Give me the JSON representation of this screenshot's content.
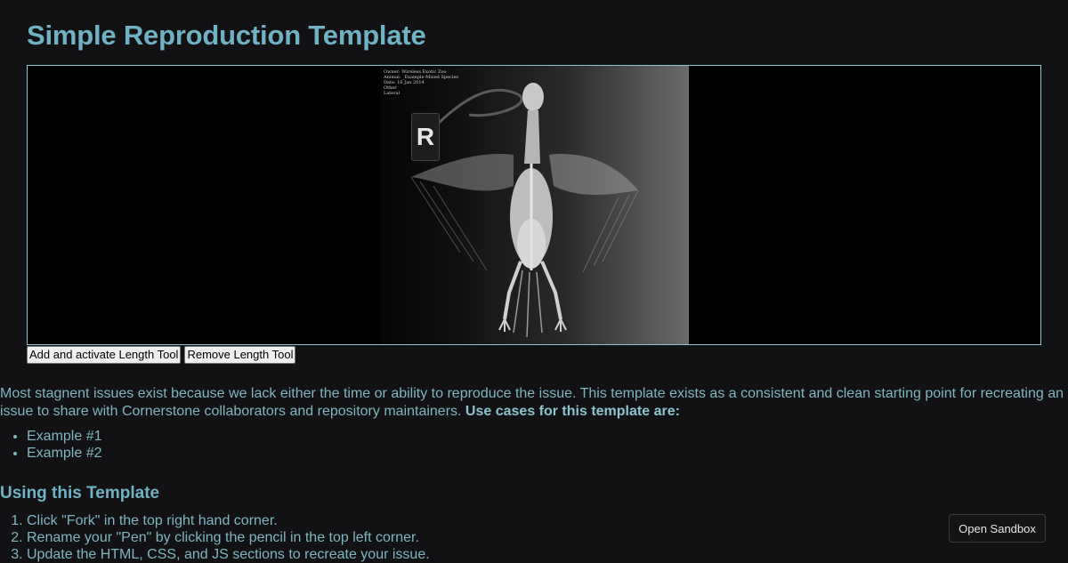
{
  "page": {
    "title": "Simple Reproduction Template"
  },
  "viewport": {
    "overlay_lines": [
      "Owner: Wireless Exotic Zoo",
      "Animal: _Example-Mixed Species",
      "Date: 16 Jan 2014",
      "Other",
      "Lateral"
    ],
    "marker_letter": "R"
  },
  "toolbar": {
    "add_length_label": "Add and activate Length Tool",
    "remove_length_label": "Remove Length Tool"
  },
  "intro": {
    "text": "Most stagnent issues exist because we lack either the time or ability to reproduce the issue. This template exists as a consistent and clean starting point for recreating an issue to share with Cornerstone collaborators and repository maintainers. ",
    "strong": "Use cases for this template are:"
  },
  "examples": [
    "Example #1",
    "Example #2"
  ],
  "using": {
    "title": "Using this Template",
    "steps": [
      "Click \"Fork\" in the top right hand corner.",
      "Rename your \"Pen\" by clicking the pencil in the top left corner.",
      "Update the HTML, CSS, and JS sections to recreate your issue."
    ]
  },
  "sandbox": {
    "label": "Open Sandbox"
  },
  "colors": {
    "background": "#121113",
    "text": "#7fb6c2",
    "heading": "#6fb2c4",
    "viewport_border": "#8fc3cf"
  }
}
